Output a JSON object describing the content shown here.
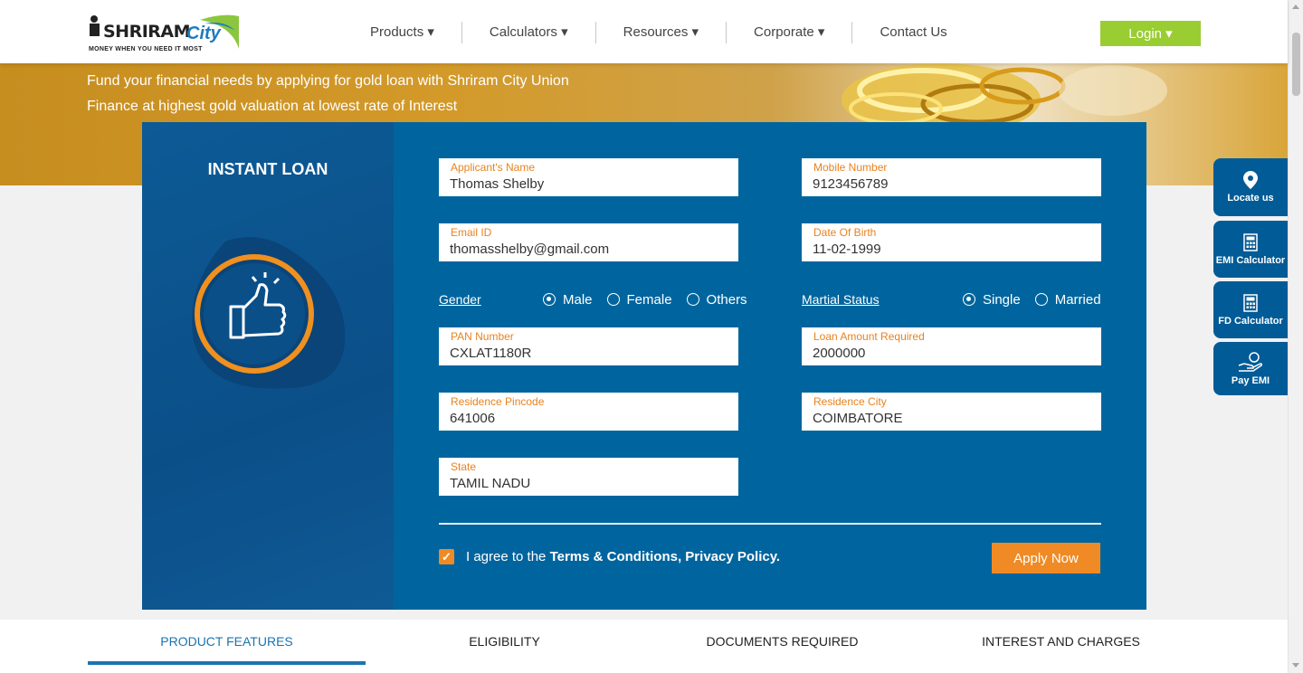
{
  "header": {
    "logo_main": "SHRIRAM",
    "logo_city": "City",
    "logo_tagline": "MONEY WHEN YOU NEED IT MOST",
    "nav": [
      {
        "label": "Products ▾"
      },
      {
        "label": "Calculators ▾"
      },
      {
        "label": "Resources ▾"
      },
      {
        "label": "Corporate ▾"
      },
      {
        "label": "Contact Us"
      }
    ],
    "login_label": "Login ▾"
  },
  "banner": {
    "text_line1": "Fund your financial needs by applying for gold loan with Shriram City Union",
    "text_line2": "Finance at highest gold valuation at lowest rate of Interest"
  },
  "form": {
    "title": "INSTANT LOAN",
    "applicant_name": {
      "label": "Applicant's Name",
      "value": "Thomas Shelby"
    },
    "mobile": {
      "label": "Mobile Number",
      "value": "9123456789"
    },
    "email": {
      "label": "Email ID",
      "value": "thomasshelby@gmail.com"
    },
    "dob": {
      "label": "Date Of Birth",
      "value": "11-02-1999"
    },
    "gender": {
      "label": "Gender",
      "options": [
        "Male",
        "Female",
        "Others"
      ],
      "selected": "Male"
    },
    "marital": {
      "label": "Martial Status",
      "options": [
        "Single",
        "Married"
      ],
      "selected": "Single"
    },
    "pan": {
      "label": "PAN Number",
      "value": "CXLAT1180R"
    },
    "loan_amount": {
      "label": "Loan Amount Required",
      "value": "2000000"
    },
    "pincode": {
      "label": "Residence Pincode",
      "value": "641006"
    },
    "city": {
      "label": "Residence City",
      "value": "COIMBATORE"
    },
    "state": {
      "label": "State",
      "value": "TAMIL NADU"
    },
    "agree_prefix": "I agree to the ",
    "agree_terms": "Terms & Conditions, Privacy Policy.",
    "agree_checked": true,
    "apply_label": "Apply Now"
  },
  "side_widgets": [
    {
      "label": "Locate us",
      "icon": "map-pin-icon"
    },
    {
      "label": "EMI Calculator",
      "icon": "calculator-icon"
    },
    {
      "label": "FD Calculator",
      "icon": "calculator-icon"
    },
    {
      "label": "Pay EMI",
      "icon": "hand-coin-icon"
    }
  ],
  "tabs": [
    {
      "label": "PRODUCT FEATURES",
      "active": true
    },
    {
      "label": "ELIGIBILITY",
      "active": false
    },
    {
      "label": "DOCUMENTS REQUIRED",
      "active": false
    },
    {
      "label": "INTEREST AND CHARGES",
      "active": false
    }
  ],
  "colors": {
    "brand_blue": "#00659e",
    "accent_orange": "#f08a24",
    "login_green": "#9acd32"
  }
}
